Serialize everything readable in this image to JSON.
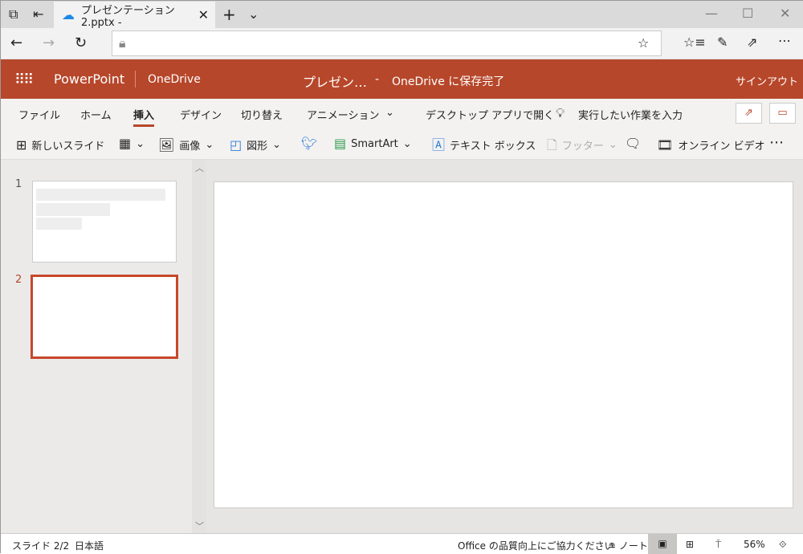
{
  "browser": {
    "tab_title": "プレゼンテーション 2.pptx -",
    "url": "",
    "icons": [
      "tab-manager-icon",
      "set-aside-icon",
      "onedrive-icon",
      "close-icon",
      "new-tab-icon",
      "chevron-down-icon",
      "minimize-icon",
      "maximize-icon",
      "close-window-icon",
      "back-icon",
      "forward-icon",
      "refresh-icon",
      "lock-icon",
      "favorite-star-icon",
      "favorites-icon",
      "pen-icon",
      "share-icon",
      "more-icon"
    ]
  },
  "header": {
    "app": "PowerPoint",
    "location": "OneDrive",
    "doc_title": "プレゼン…",
    "separator": "-",
    "save_status": "OneDrive に保存完了",
    "sign_out": "サインアウト",
    "color": "#b7472a"
  },
  "ribbon_tabs": [
    "ファイル",
    "ホーム",
    "挿入",
    "デザイン",
    "切り替え",
    "アニメーション"
  ],
  "active_tab": "挿入",
  "open_desktop": "デスクトップ アプリで開く",
  "tell_me": "実行したい作業を入力",
  "commands": {
    "new_slide": "新しいスライド",
    "image": "画像",
    "shapes": "図形",
    "smartart": "SmartArt",
    "textbox": "テキスト ボックス",
    "footer": "フッター",
    "online_video": "オンライン ビデオ"
  },
  "slides": [
    {
      "number": "1"
    },
    {
      "number": "2",
      "selected": true
    }
  ],
  "status": {
    "slide": "スライド 2/2",
    "language": "日本語",
    "feedback": "Office の品質向上にご協力ください",
    "notes": "ノート",
    "zoom": "56%"
  }
}
